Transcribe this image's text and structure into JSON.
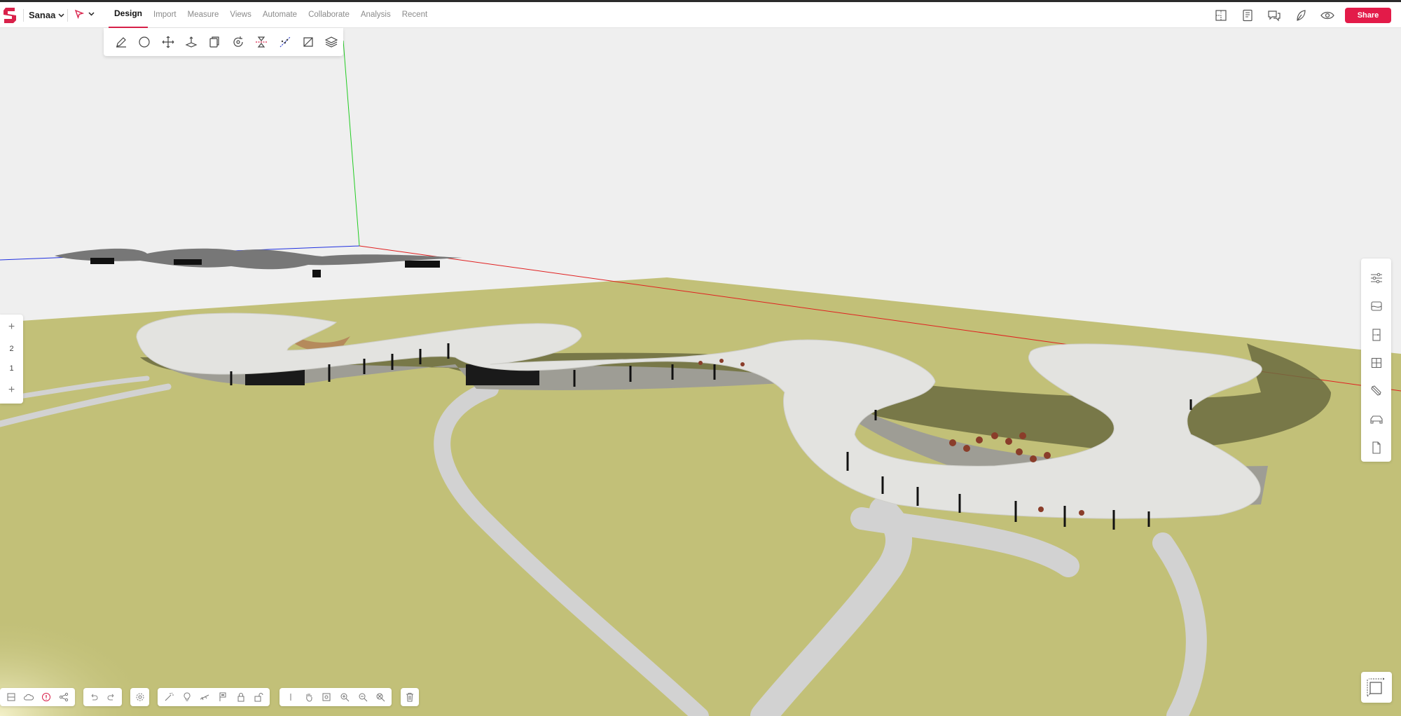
{
  "app": {
    "project_name": "Sanaa",
    "share_label": "Share",
    "accent_color": "#e31b49"
  },
  "menu": {
    "tabs": [
      {
        "label": "Design",
        "active": true
      },
      {
        "label": "Import"
      },
      {
        "label": "Measure"
      },
      {
        "label": "Views"
      },
      {
        "label": "Automate"
      },
      {
        "label": "Collaborate"
      },
      {
        "label": "Analysis"
      },
      {
        "label": "Recent"
      }
    ]
  },
  "topbar_right_icons": [
    "floorplan-view-icon",
    "report-icon",
    "comments-icon",
    "sustainability-leaf-icon",
    "visibility-eye-icon"
  ],
  "design_tools": [
    "pencil-icon",
    "circle-icon",
    "move-icon",
    "push-pull-icon",
    "offset-icon",
    "rotate-icon",
    "mirror-icon",
    "array-icon",
    "section-icon",
    "layers-icon"
  ],
  "levels": {
    "add_top": "+",
    "items": [
      "2",
      "1"
    ],
    "add_bottom": "+"
  },
  "right_panel_icons": [
    "settings-sliders-icon",
    "materials-icon",
    "door-icon",
    "window-icon",
    "brush-icon",
    "furniture-car-icon",
    "document-icon"
  ],
  "scene": {
    "ground_color": "#c2c078",
    "roof_color": "#e3e3e0",
    "path_color": "#d2d2d2",
    "axis_colors": {
      "x": "#e02020",
      "y": "#22cc22",
      "z": "#2030e0"
    }
  }
}
